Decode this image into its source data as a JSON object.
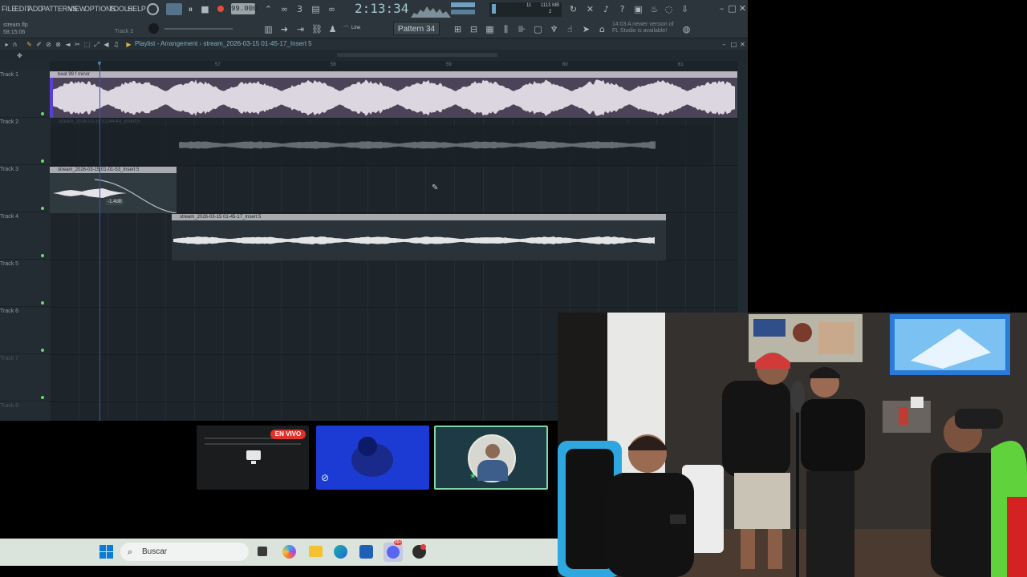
{
  "menu": [
    "FILE",
    "EDIT",
    "ADD",
    "PATTERNS",
    "VIEW",
    "OPTIONS",
    "TOOLS",
    "HELP"
  ],
  "transport": {
    "tempo": "99.000",
    "time": "2:13:34",
    "pattern": "Pattern 34",
    "snap": "Line",
    "cpu_top": "11",
    "mem": "1113 MB",
    "cpu_bottom": "2"
  },
  "file": {
    "name": "stream.flp",
    "elapsed": "58:15:06",
    "hint_track": "Track 3"
  },
  "notice": "14:03 A newer version of FL Studio is available!",
  "playlist": {
    "title": "Playlist - Arrangement",
    "breadcrumb": "stream_2026-03-15 01-45-17_Insert 5"
  },
  "ruler": [
    "57",
    "58",
    "59",
    "60",
    "61"
  ],
  "tracks": [
    "Track 1",
    "Track 2",
    "Track 3",
    "Track 4",
    "Track 5",
    "Track 6",
    "Track 7",
    "Track 8"
  ],
  "clips": {
    "beat": "beat 99 f minor",
    "track2": "stream_2026-03-15 01-44-43_Insert 5",
    "track3": "stream_2026-03-15 01-01-53_Insert 5",
    "track3_gain": "-1.4dB",
    "track4": "stream_2026-03-15 01-45-17_Insert 5"
  },
  "preview": {
    "live_badge": "EN VIVO"
  },
  "taskbar": {
    "search_placeholder": "Buscar",
    "discord_badge": "99+"
  },
  "colors": {
    "fl_background": "#1f2a31",
    "beat_clip": "#d9d2dc",
    "clip_header": "#b9b3bf",
    "live_red": "#e0322c",
    "selected_preview_border": "#7fd6a6",
    "blue_preview": "#1c3bd4",
    "playhead": "#3257b3"
  }
}
